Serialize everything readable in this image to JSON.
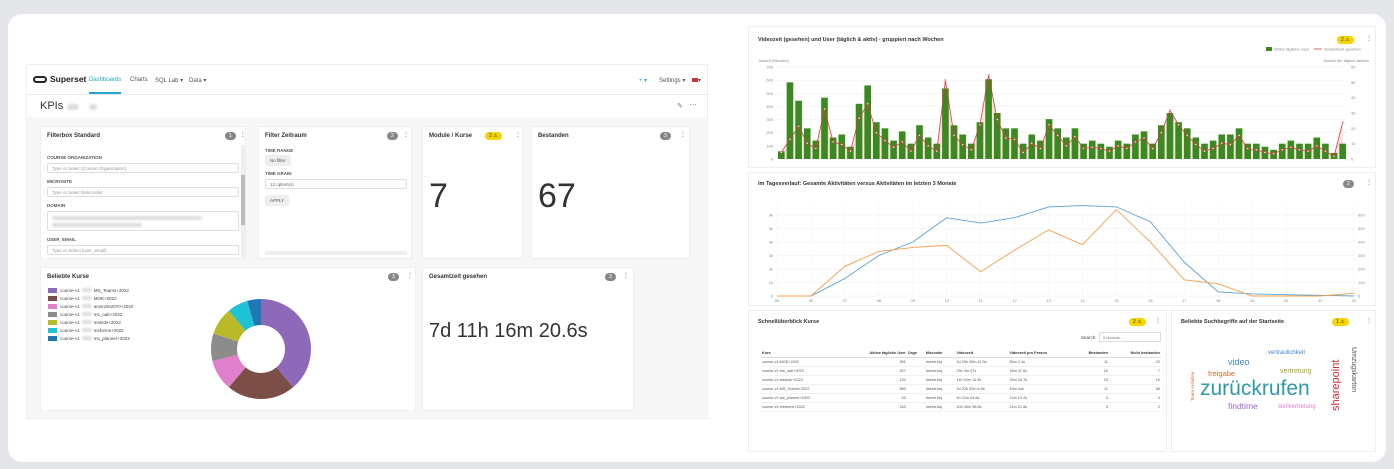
{
  "nav": {
    "brand": "Superset",
    "items": [
      "Dashboards",
      "Charts",
      "SQL Lab ▾",
      "Data ▾"
    ],
    "plus": "+ ▾",
    "settings": "Settings ▾",
    "flag": "▾"
  },
  "dashboard": {
    "title": "KPIs"
  },
  "filterbox": {
    "title": "Filterbox Standard",
    "badge": "1",
    "fields": [
      {
        "label": "COURSE ORGANIZATION",
        "placeholder": "Type or Select [Course Organization]"
      },
      {
        "label": "MICROSITE",
        "placeholder": "Type or Select [Microsite]"
      },
      {
        "label": "DOMAIN",
        "placeholder": ""
      },
      {
        "label": "USER_EMAIL",
        "placeholder": "Type or Select [user_email]"
      }
    ]
  },
  "zeitraum": {
    "title": "Filter Zeitraum",
    "badge": "2",
    "time_range_label": "TIME RANGE",
    "time_range_value": "No filter",
    "time_grain_label": "TIME GRAIN",
    "time_grain_value": "12 option(s)",
    "apply": "APPLY"
  },
  "module": {
    "title": "Module / Kurse",
    "badge": "2",
    "value": "7"
  },
  "bestanden": {
    "title": "Bestanden",
    "badge": "3",
    "value": "67"
  },
  "beliebte": {
    "title": "Beliebte Kurse",
    "badge": "3",
    "legend": [
      {
        "label": "MS_Teams+2022",
        "color": "#8e68b9"
      },
      {
        "label": "MOE+2022",
        "color": "#7b4f48"
      },
      {
        "label": "ansmzte2070+2022",
        "color": "#e07fcb"
      },
      {
        "label": "ms_oab+2022",
        "color": "#8c8c8c"
      },
      {
        "label": "msteds+2022",
        "color": "#b8ba2a"
      },
      {
        "label": "msforms+2022",
        "color": "#1ec2d6"
      },
      {
        "label": "ms_planner+2022",
        "color": "#1f77b4"
      }
    ],
    "slice_prefix": "course-v1",
    "values": [
      35,
      20,
      9,
      8,
      8,
      6,
      4
    ]
  },
  "gesamtzeit": {
    "title": "Gesamtzeit gesehen",
    "badge": "3",
    "value": "7d 11h 16m 20.6s"
  },
  "videozeit": {
    "title": "Videozeit (gesehen) und User (täglich & aktiv) - gruppiert nach Wochen",
    "badge": "2",
    "legend_bar": "Aktive tägliche User",
    "legend_line": "Gesamtzeit gesehen",
    "ylabel_left": "Idezeit (Minuten)",
    "ylabel_right": "Anzahl der täglich aktiven",
    "yticks_left": [
      "700",
      "600",
      "500",
      "400",
      "300",
      "200",
      "100",
      "0"
    ],
    "yticks_right": [
      "60",
      "50",
      "40",
      "30",
      "20",
      "10",
      "0"
    ],
    "bar_color": "#3a8a1f",
    "line_color": "#e0393e"
  },
  "tagesverlauf": {
    "title": "Im Tagesverlauf: Gesamte Aktivitäten versus Aktivitäten im letzten 3 Monate",
    "badge": "2",
    "yticks_left": [
      "6k",
      "5k",
      "4k",
      "3k",
      "2k",
      "1k",
      "0"
    ],
    "yticks_right": [
      "600",
      "500",
      "400",
      "300",
      "200",
      "100",
      "0"
    ],
    "blue_color": "#5aa2d5",
    "orange_color": "#f5a04a"
  },
  "schnell": {
    "title": "Schnellüberblick Kurse",
    "badge": "2",
    "search_label": "Search:",
    "search_placeholder": "0 records...",
    "headers": [
      "Kurs",
      "Aktive tägliche User",
      "Orga",
      "Microsite",
      "Videozeit",
      "Videozeit pro Person",
      "Bestanden",
      "Nicht bestanden"
    ],
    "rows": [
      [
        "course-v1:MOE+2022",
        "391",
        "",
        "hsentr.biq",
        "1d 20h 50m 11.3s",
        "30m 2.4s",
        "11",
        "22"
      ],
      [
        "course-v1:ms_oab+2022",
        "207",
        "",
        "hsentr.biq",
        "23h 3m 47s",
        "18m 47.6s",
        "16",
        "7"
      ],
      [
        "course-v1:mstodo+2022",
        "134",
        "",
        "hsentr.biq",
        "11h 24m 12.9s",
        "15m 34.7s",
        "23",
        "10"
      ],
      [
        "course-v1:MS_Teams+2022",
        "589",
        "",
        "hsentr.biq",
        "2d 22h 52m 6.9s",
        "43m 44s",
        "11",
        "36"
      ],
      [
        "course-v1:ms_planner+2022",
        "53",
        "",
        "hsentr.biq",
        "4h 21m 44.6s",
        "12m 10.2s",
        "3",
        "4"
      ],
      [
        "course-v1:msforms+2022",
        "183",
        "",
        "hsentr.biq",
        "10h 40m 58.8s",
        "21m 21.8s",
        "3",
        "2"
      ]
    ]
  },
  "wordcloud": {
    "title": "Beliebte Suchbegriffe auf der Startseite",
    "badge": "1",
    "words": [
      {
        "text": "zurückrufen",
        "color": "#2f9aa8"
      },
      {
        "text": "sharepoint",
        "color": "#d6272f"
      },
      {
        "text": "video",
        "color": "#3b86d6"
      },
      {
        "text": "vertraulichkeit",
        "color": "#3b86d6"
      },
      {
        "text": "freigabe",
        "color": "#e26a2c"
      },
      {
        "text": "vertretung",
        "color": "#a6a61f"
      },
      {
        "text": "findtime",
        "color": "#9a65c8"
      },
      {
        "text": "stellvertretung",
        "color": "#e27dc8"
      },
      {
        "text": "Umzugskarton",
        "color": "#555555"
      },
      {
        "text": "Team erstellen",
        "color": "#e26a2c"
      }
    ]
  },
  "chart_data": [
    {
      "type": "pie",
      "title": "Beliebte Kurse",
      "categories": [
        "MS_Teams+2022",
        "MOE+2022",
        "ansmzte2070+2022",
        "ms_oab+2022",
        "msteds+2022",
        "msforms+2022",
        "ms_planner+2022"
      ],
      "values": [
        35,
        20,
        9,
        8,
        8,
        6,
        4
      ]
    },
    {
      "type": "bar",
      "title": "Videozeit (gesehen) und User (täglich & aktiv) - gruppiert nach Wochen",
      "series": [
        {
          "name": "Aktive tägliche User",
          "values": [
            5,
            50,
            38,
            20,
            12,
            40,
            14,
            16,
            8,
            36,
            48,
            24,
            20,
            12,
            18,
            10,
            22,
            14,
            10,
            46,
            22,
            16,
            10,
            24,
            52,
            30,
            20,
            20,
            10,
            16,
            12,
            26,
            20,
            14,
            20,
            10,
            12,
            10,
            8,
            12,
            10,
            16,
            18,
            10,
            22,
            30,
            24,
            20,
            14,
            10,
            12,
            16,
            16,
            20,
            10,
            10,
            8,
            6,
            10,
            12,
            10,
            10,
            14,
            10,
            4,
            10
          ]
        },
        {
          "name": "Gesamtzeit gesehen",
          "values": [
            50,
            150,
            250,
            120,
            80,
            380,
            130,
            110,
            60,
            310,
            420,
            200,
            140,
            90,
            130,
            60,
            180,
            100,
            60,
            600,
            180,
            110,
            70,
            260,
            640,
            300,
            160,
            150,
            50,
            120,
            80,
            260,
            180,
            100,
            170,
            80,
            90,
            80,
            60,
            100,
            80,
            130,
            160,
            80,
            200,
            370,
            260,
            180,
            110,
            60,
            80,
            120,
            110,
            180,
            80,
            70,
            50,
            40,
            70,
            90,
            70,
            60,
            100,
            60,
            20,
            280
          ]
        }
      ],
      "ylim": [
        0,
        700
      ],
      "grid": true,
      "legend": "top-right"
    },
    {
      "type": "line",
      "title": "Im Tagesverlauf: Gesamte Aktivitäten versus Aktivitäten im letzten 3 Monate",
      "x": [
        5,
        6,
        7,
        8,
        9,
        10,
        11,
        12,
        13,
        14,
        15,
        16,
        17,
        18,
        19,
        20,
        21,
        22
      ],
      "series": [
        {
          "values": [
            0,
            0,
            1300,
            3000,
            4000,
            5800,
            5400,
            5800,
            6600,
            6700,
            6600,
            5500,
            2500,
            300,
            150,
            100,
            50,
            0
          ]
        },
        {
          "values": [
            0,
            0,
            220,
            330,
            360,
            375,
            180,
            340,
            490,
            380,
            640,
            400,
            120,
            90,
            0,
            0,
            0,
            20
          ]
        }
      ],
      "grid": true
    }
  ]
}
